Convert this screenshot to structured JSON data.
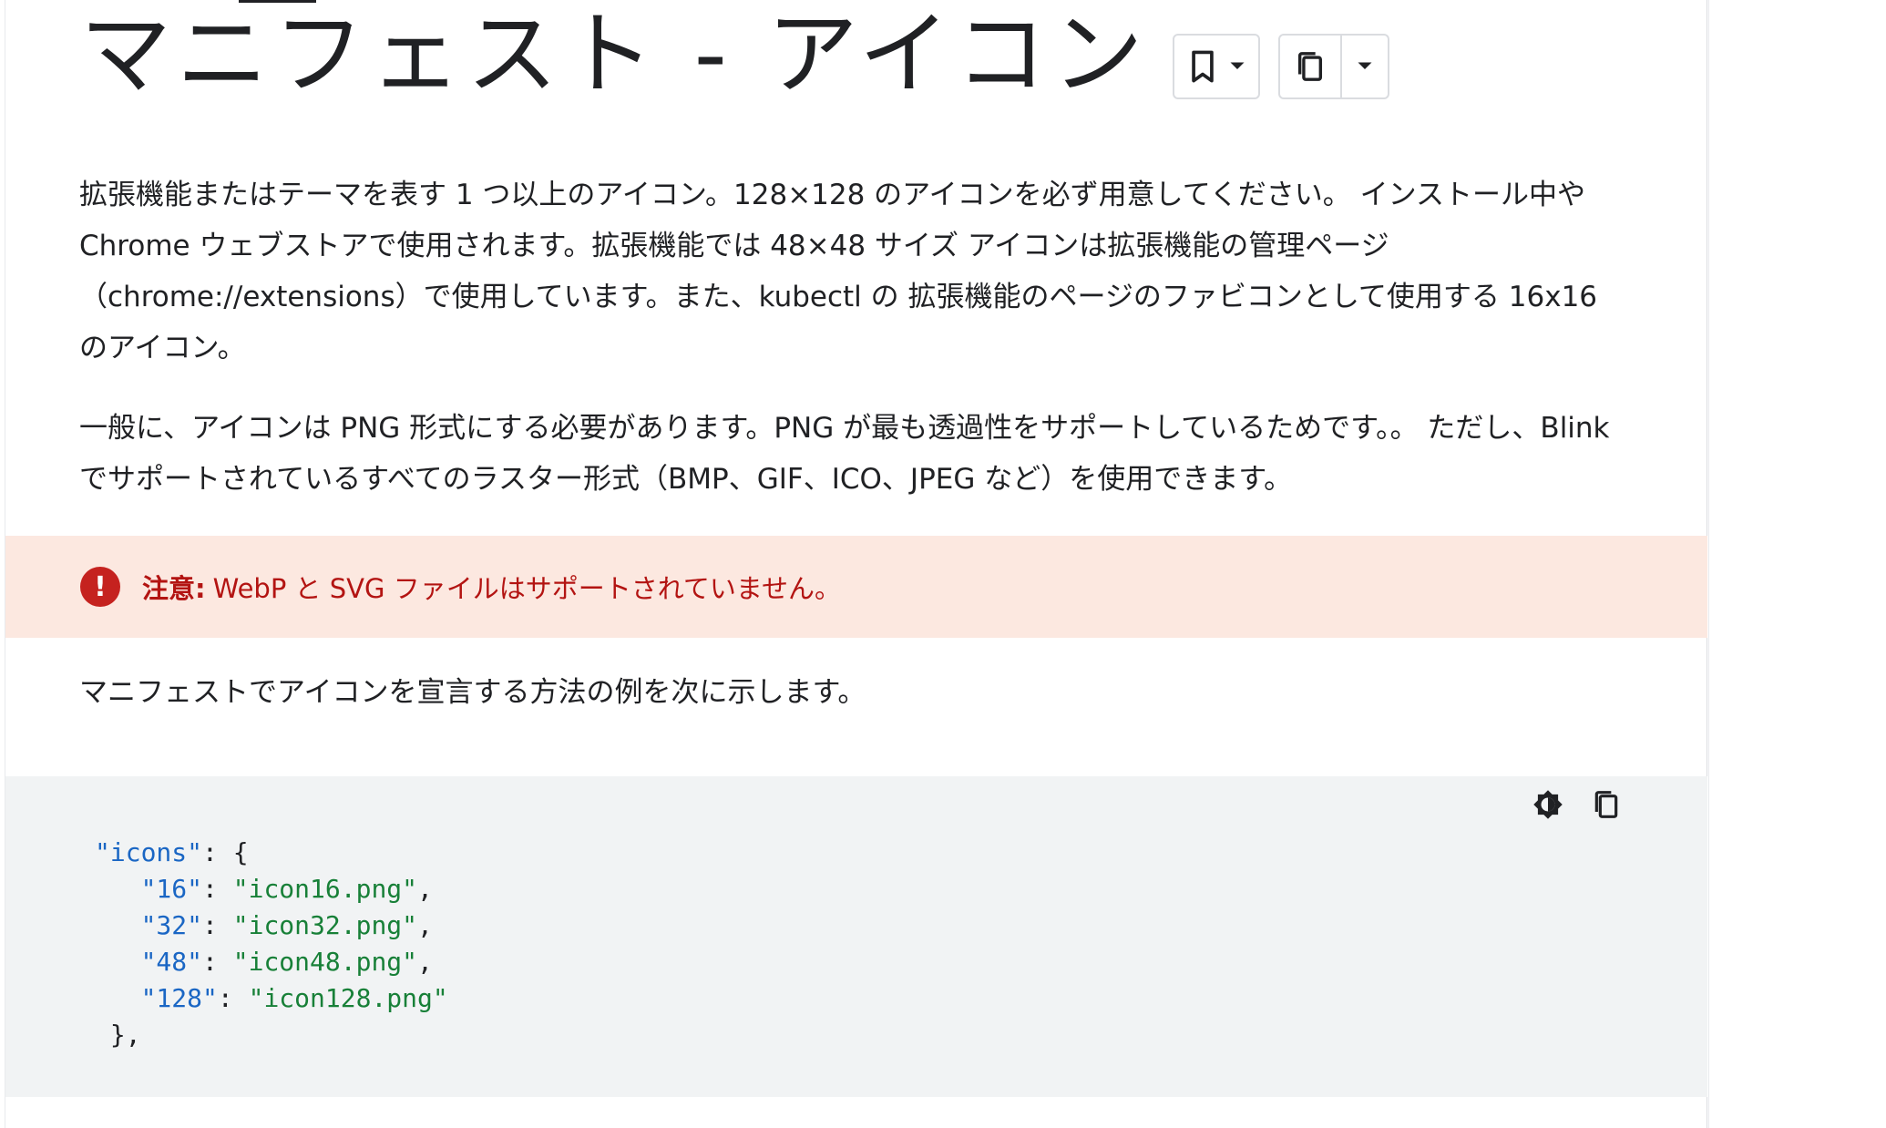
{
  "title": "マニフェスト - アイコン",
  "icons": {
    "bookmark": "bookmark-icon",
    "bookmark_dropdown": "chevron-down-icon",
    "copy": "copy-icon",
    "copy_dropdown": "chevron-down-icon",
    "caution": "error-icon",
    "theme_toggle": "theme-toggle-icon",
    "code_copy": "copy-icon"
  },
  "paragraphs": {
    "p1": "拡張機能またはテーマを表す 1 つ以上のアイコン。128×128 のアイコンを必ず用意してください。 インストール中や Chrome ウェブストアで使用されます。拡張機能では 48×48 サイズ アイコンは拡張機能の管理ページ（chrome://extensions）で使用しています。また、kubectl の 拡張機能のページのファビコンとして使用する 16x16 のアイコン。",
    "p2": "一般に、アイコンは PNG 形式にする必要があります。PNG が最も透過性をサポートしているためです。。 ただし、Blink でサポートされているすべてのラスター形式（BMP、GIF、ICO、JPEG など）を使用できます。",
    "p3": "マニフェストでアイコンを宣言する方法の例を次に示します。"
  },
  "caution": {
    "label": "注意:",
    "text": "WebP と SVG ファイルはサポートされていません。",
    "icon_glyph": "!"
  },
  "code": {
    "key": "\"icons\"",
    "entries": [
      {
        "k": "\"16\"",
        "v": "\"icon16.png\""
      },
      {
        "k": "\"32\"",
        "v": "\"icon32.png\""
      },
      {
        "k": "\"48\"",
        "v": "\"icon48.png\""
      },
      {
        "k": "\"128\"",
        "v": "\"icon128.png\""
      }
    ],
    "colon": ": ",
    "open": "{",
    "close": "},",
    "comma": ","
  },
  "colors": {
    "caution_bg": "#fce8e0",
    "caution_text": "#b31412",
    "code_bg": "#f1f3f4",
    "code_key": "#1a66c4",
    "code_string": "#188038"
  }
}
